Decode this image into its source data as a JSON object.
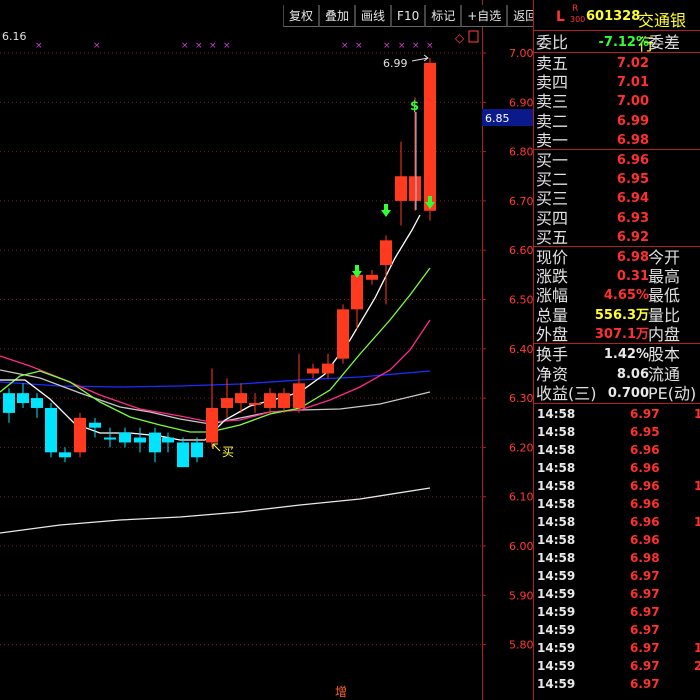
{
  "toolbar": {
    "buttons": [
      "复权",
      "叠加",
      "画线",
      "F10",
      "标记",
      "+自选",
      "返回"
    ]
  },
  "chart": {
    "top_left_value": "6.16",
    "y_axis_ticks": [
      "7.00",
      "6.90",
      "6.80",
      "6.70",
      "6.60",
      "6.50",
      "6.40",
      "6.30",
      "6.20",
      "6.10",
      "6.00",
      "5.90",
      "5.80"
    ],
    "current_price_tag": "6.85",
    "high_label": "6.99",
    "buy_label": "买",
    "bottom_label": "增",
    "colors": {
      "up": "#ff3a1f",
      "down": "#00e5ff",
      "grid": "#7a1818",
      "ma5": "#ffffff",
      "ma10": "#7cff3a",
      "ma20": "#ff2a8a",
      "ma30": "#c8c8c8",
      "ma60": "#1c2cff",
      "ma120": "#e8e8e8"
    }
  },
  "quote": {
    "header": {
      "prefix": "L",
      "badge_top": "R",
      "badge_bottom": "300",
      "code": "601328",
      "name": "交通银行"
    },
    "weibi": {
      "label": "委比",
      "value": "-7.12%",
      "label2": "委差"
    },
    "asks": [
      {
        "label": "卖五",
        "price": "7.02"
      },
      {
        "label": "卖四",
        "price": "7.01"
      },
      {
        "label": "卖三",
        "price": "7.00"
      },
      {
        "label": "卖二",
        "price": "6.99"
      },
      {
        "label": "卖一",
        "price": "6.98"
      }
    ],
    "bids": [
      {
        "label": "买一",
        "price": "6.96"
      },
      {
        "label": "买二",
        "price": "6.95"
      },
      {
        "label": "买三",
        "price": "6.94"
      },
      {
        "label": "买四",
        "price": "6.93"
      },
      {
        "label": "买五",
        "price": "6.92"
      }
    ],
    "stats": [
      {
        "label": "现价",
        "value": "6.98",
        "label2": "今开",
        "color": "red"
      },
      {
        "label": "涨跌",
        "value": "0.31",
        "label2": "最高",
        "color": "red"
      },
      {
        "label": "涨幅",
        "value": "4.65%",
        "label2": "最低",
        "color": "red"
      },
      {
        "label": "总量",
        "value": "556.3万",
        "label2": "量比",
        "color": "yel"
      },
      {
        "label": "外盘",
        "value": "307.1万",
        "label2": "内盘",
        "color": "red"
      }
    ],
    "stats2": [
      {
        "label": "换手",
        "value": "1.42%",
        "label2": "股本",
        "color": "wht"
      },
      {
        "label": "净资",
        "value": "8.06",
        "label2": "流通",
        "color": "wht"
      },
      {
        "label": "收益(三)",
        "value": "0.700",
        "label2": "PE(动)",
        "color": "wht"
      }
    ],
    "ticks": [
      {
        "time": "14:58",
        "price": "6.97",
        "vol": "1",
        "vcolor": "red"
      },
      {
        "time": "14:58",
        "price": "6.95",
        "vol": "",
        "vcolor": "red"
      },
      {
        "time": "14:58",
        "price": "6.96",
        "vol": "",
        "vcolor": "red"
      },
      {
        "time": "14:58",
        "price": "6.96",
        "vol": "",
        "vcolor": "red"
      },
      {
        "time": "14:58",
        "price": "6.96",
        "vol": "1",
        "vcolor": "red"
      },
      {
        "time": "14:58",
        "price": "6.96",
        "vol": "",
        "vcolor": "red"
      },
      {
        "time": "14:58",
        "price": "6.96",
        "vol": "1",
        "vcolor": "red"
      },
      {
        "time": "14:58",
        "price": "6.96",
        "vol": "",
        "vcolor": "red"
      },
      {
        "time": "14:58",
        "price": "6.98",
        "vol": "",
        "vcolor": "red"
      },
      {
        "time": "14:59",
        "price": "6.97",
        "vol": "",
        "vcolor": "red"
      },
      {
        "time": "14:59",
        "price": "6.97",
        "vol": "",
        "vcolor": "red"
      },
      {
        "time": "14:59",
        "price": "6.97",
        "vol": "",
        "vcolor": "red"
      },
      {
        "time": "14:59",
        "price": "6.97",
        "vol": "",
        "vcolor": "red"
      },
      {
        "time": "14:59",
        "price": "6.97",
        "vol": "1",
        "vcolor": "red"
      },
      {
        "time": "14:59",
        "price": "6.97",
        "vol": "2",
        "vcolor": "red"
      },
      {
        "time": "14:59",
        "price": "6.97",
        "vol": "",
        "vcolor": "red"
      }
    ]
  }
}
